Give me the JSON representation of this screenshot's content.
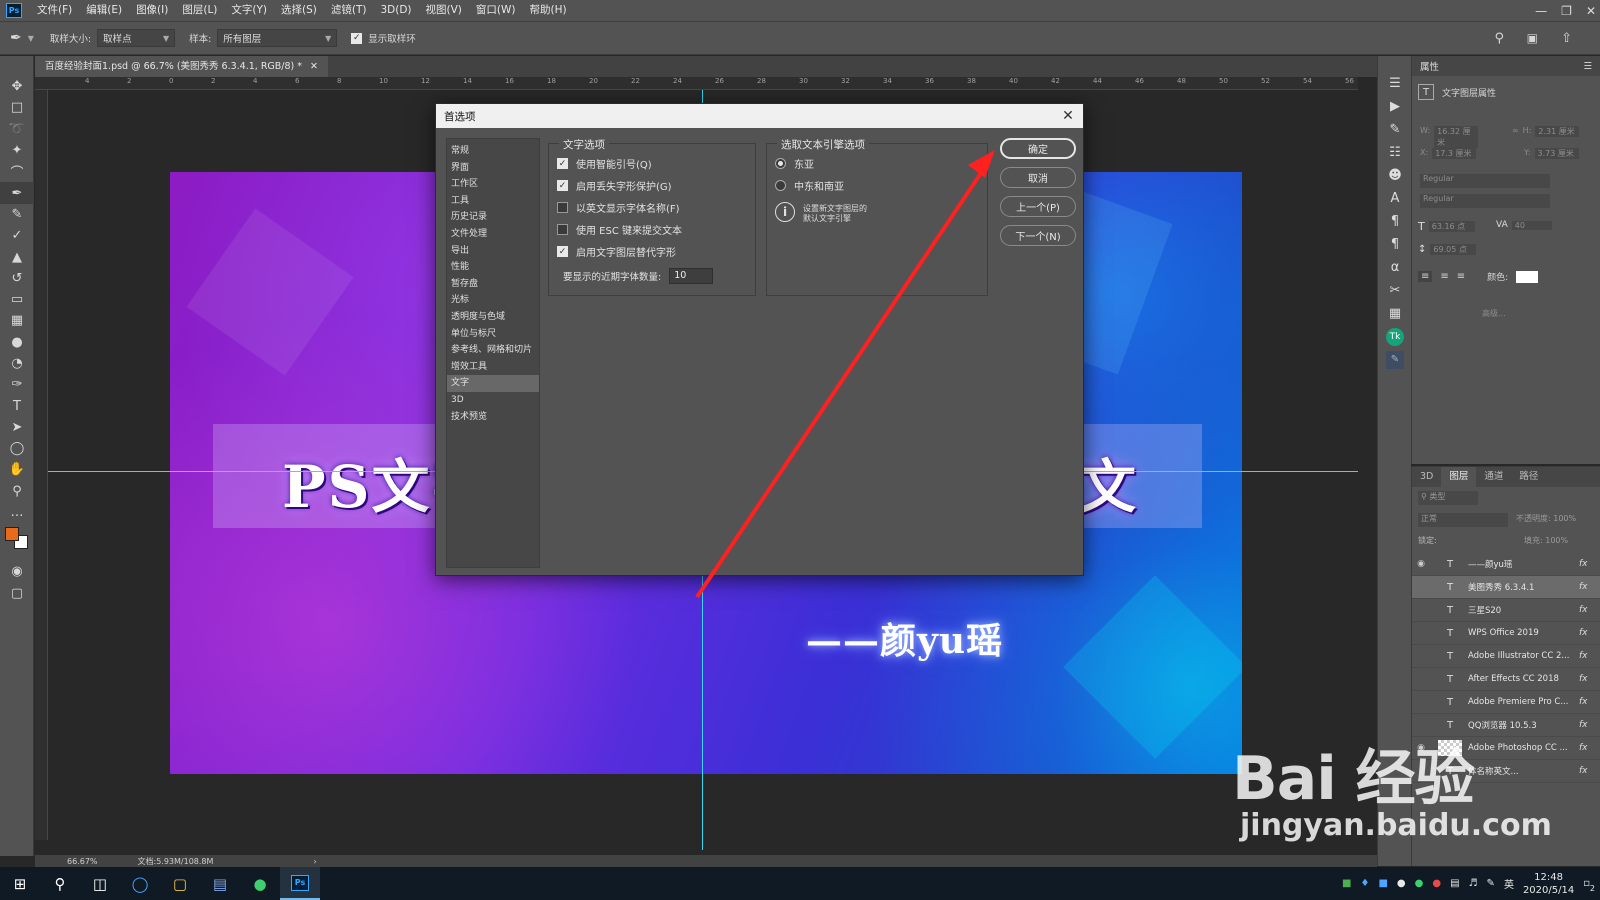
{
  "app": {
    "logo": "Ps"
  },
  "menu": [
    "文件(F)",
    "编辑(E)",
    "图像(I)",
    "图层(L)",
    "文字(Y)",
    "选择(S)",
    "滤镜(T)",
    "3D(D)",
    "视图(V)",
    "窗口(W)",
    "帮助(H)"
  ],
  "options_bar": {
    "sample_size_label": "取样大小:",
    "sample_size_value": "取样点",
    "sample_label": "样本:",
    "sample_value": "所有图层",
    "show_ring_label": "显示取样环"
  },
  "document": {
    "tab_title": "百度经验封面1.psd @ 66.7% (美图秀秀 6.3.4.1, RGB/8) *",
    "ruler_marks": [
      "4",
      "2",
      "0",
      "2",
      "4",
      "6",
      "8",
      "10",
      "12",
      "14",
      "16",
      "18",
      "20",
      "22",
      "24",
      "26",
      "28",
      "30",
      "32",
      "34",
      "36",
      "38",
      "40",
      "42",
      "44",
      "46",
      "48",
      "50",
      "52",
      "54",
      "56"
    ],
    "zoom": "66.67%",
    "doc_size": "文档:5.93M/108.8M"
  },
  "canvas": {
    "title_left": "PS文字",
    "title_right": "文",
    "signature": "——颜yu瑶"
  },
  "dialog": {
    "title": "首选项",
    "nav": [
      "常规",
      "界面",
      "工作区",
      "工具",
      "历史记录",
      "文件处理",
      "导出",
      "性能",
      "暂存盘",
      "光标",
      "透明度与色域",
      "单位与标尺",
      "参考线、网格和切片",
      "增效工具",
      "文字",
      "3D",
      "技术预览"
    ],
    "nav_selected": "文字",
    "text_options": {
      "title": "文字选项",
      "items": [
        {
          "label": "使用智能引号(Q)",
          "checked": true
        },
        {
          "label": "启用丢失字形保护(G)",
          "checked": true
        },
        {
          "label": "以英文显示字体名称(F)",
          "checked": false
        },
        {
          "label": "使用 ESC 键来提交文本",
          "checked": false
        },
        {
          "label": "启用文字图层替代字形",
          "checked": true
        }
      ],
      "recent_fonts_label": "要显示的近期字体数量:",
      "recent_fonts_value": "10"
    },
    "engine_options": {
      "title": "选取文本引擎选项",
      "east_asian": "东亚",
      "middle_east": "中东和南亚",
      "selected": "东亚",
      "info_text_1": "设置新文字图层的",
      "info_text_2": "默认文字引擎"
    },
    "buttons": {
      "ok": "确定",
      "cancel": "取消",
      "prev": "上一个(P)",
      "next": "下一个(N)"
    }
  },
  "properties": {
    "tab": "属性",
    "subtitle": "文字图层属性",
    "w_label": "W:",
    "w_value": "16.32 厘米",
    "h_label": "H:",
    "h_value": "2.31 厘米",
    "x_label": "X:",
    "x_value": "17.3 厘米",
    "y_label": "Y:",
    "y_value": "3.73 厘米",
    "font_style": "Regular",
    "size_value": "63.16 点",
    "tracking_value": "40",
    "leading_value": "69.05 点",
    "color_label": "颜色:",
    "more_label": "高级..."
  },
  "layers": {
    "tabs": [
      "3D",
      "图层",
      "通道",
      "路径"
    ],
    "active_tab": "图层",
    "filter_label": "类型",
    "blend_mode": "正常",
    "opacity_label": "不透明度:",
    "opacity_value": "100%",
    "lock_label": "锁定:",
    "fill_label": "填充:",
    "fill_value": "100%",
    "items": [
      {
        "name": "——颜yu瑶",
        "visible": true
      },
      {
        "name": "美图秀秀 6.3.4.1",
        "visible": false,
        "selected": true
      },
      {
        "name": "三星S20",
        "visible": false
      },
      {
        "name": "WPS Office 2019",
        "visible": false
      },
      {
        "name": "Adobe Illustrator CC 2...",
        "visible": false
      },
      {
        "name": "After Effects CC 2018",
        "visible": false
      },
      {
        "name": "Adobe Premiere Pro C...",
        "visible": false
      },
      {
        "name": "QQ浏览器 10.5.3",
        "visible": false
      },
      {
        "name": "Adobe Photoshop CC ...",
        "visible": true
      },
      {
        "name": "体名称英文...",
        "visible": false
      }
    ]
  },
  "taskbar": {
    "time": "12:48",
    "date": "2020/5/14",
    "notif_count": "2",
    "ime": "英"
  },
  "watermark": {
    "brand": "Bai 经验",
    "url": "jingyan.baidu.com"
  },
  "colors": {
    "accent_red": "#ff2020",
    "guide": "#3ad7ee",
    "ui_bg": "#535353"
  }
}
